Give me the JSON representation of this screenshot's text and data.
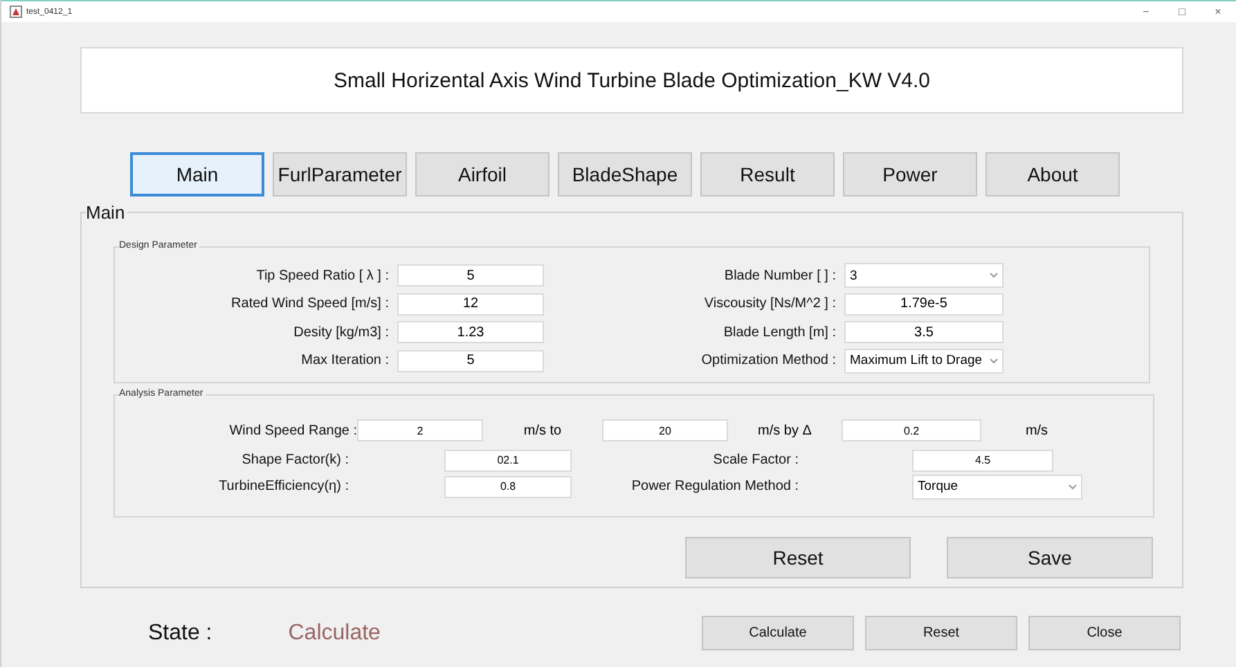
{
  "window": {
    "title": "test_0412_1",
    "controls": [
      "−",
      "□",
      "×"
    ]
  },
  "app_title": "Small Horizental Axis Wind Turbine Blade Optimization_KW V4.0",
  "tabs": [
    {
      "label": "Main",
      "selected": true
    },
    {
      "label": "FurlParameter",
      "selected": false
    },
    {
      "label": "Airfoil",
      "selected": false
    },
    {
      "label": "BladeShape",
      "selected": false
    },
    {
      "label": "Result",
      "selected": false
    },
    {
      "label": "Power",
      "selected": false
    },
    {
      "label": "About",
      "selected": false
    }
  ],
  "panel": {
    "title": "Main",
    "design_parameter": {
      "title": "Design Parameter",
      "left": [
        {
          "label": "Tip Speed Ratio [ λ ] :",
          "value": "5",
          "kind": "text"
        },
        {
          "label": "Rated Wind Speed [m/s] :",
          "value": "12",
          "kind": "text"
        },
        {
          "label": "Desity [kg/m3] :",
          "value": "1.23",
          "kind": "text"
        },
        {
          "label": "Max Iteration :",
          "value": "5",
          "kind": "text"
        }
      ],
      "right": [
        {
          "label": "Blade Number [ ] :",
          "value": "3",
          "kind": "select"
        },
        {
          "label": "Viscousity [Ns/M^2 ] :",
          "value": "1.79e-5",
          "kind": "text"
        },
        {
          "label": "Blade Length [m] :",
          "value": "3.5",
          "kind": "text"
        },
        {
          "label": "Optimization Method :",
          "value": "Maximum Lift to Drage",
          "kind": "select"
        }
      ]
    },
    "analysis_parameter": {
      "title": "Analysis Parameter",
      "wind_speed_range": {
        "label": "Wind Speed Range :",
        "from": "2",
        "to_label": "m/s to",
        "to": "20",
        "step_label": "m/s by Δ",
        "step": "0.2",
        "unit": "m/s"
      },
      "left": [
        {
          "label": "Shape Factor(k) :",
          "value": "02.1",
          "kind": "text"
        },
        {
          "label": "TurbineEfficiency(η) :",
          "value": "0.8",
          "kind": "text"
        }
      ],
      "right": [
        {
          "label": "Scale Factor :",
          "value": "4.5",
          "kind": "text"
        },
        {
          "label": "Power Regulation Method :",
          "value": "Torque",
          "kind": "select"
        }
      ]
    },
    "buttons": [
      "Reset",
      "Save"
    ]
  },
  "state": {
    "label": "State :",
    "value": "Calculate"
  },
  "bottom_buttons": [
    "Calculate",
    "Reset",
    "Close"
  ]
}
